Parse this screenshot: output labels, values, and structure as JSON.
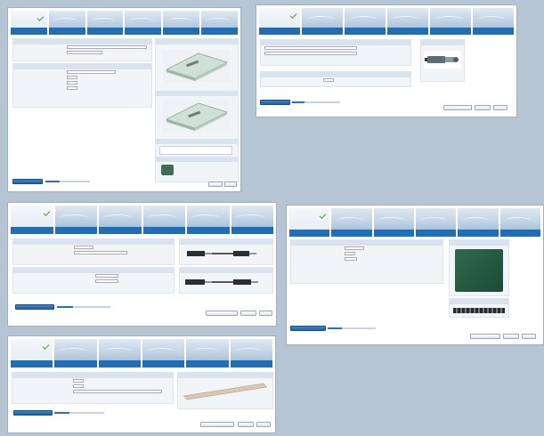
{
  "panels": [
    {
      "id": "p1",
      "tabs": [
        "",
        "",
        "",
        "",
        "",
        ""
      ],
      "active": 0,
      "section_titles": [
        "",
        "",
        ""
      ],
      "rows": [
        "",
        "",
        "",
        "",
        "",
        ""
      ],
      "buttons": [
        "",
        ""
      ],
      "logo": ""
    },
    {
      "id": "p2",
      "tabs": [
        "",
        "",
        "",
        "",
        "",
        ""
      ],
      "active": 0,
      "section_titles": [
        "",
        "",
        ""
      ],
      "rows": [
        "",
        "",
        ""
      ],
      "buttons": [
        "",
        "",
        ""
      ],
      "logo": ""
    },
    {
      "id": "p3",
      "tabs": [
        "",
        "",
        "",
        "",
        "",
        ""
      ],
      "active": 0,
      "section_titles": [
        "",
        "",
        "",
        ""
      ],
      "rows": [
        "",
        "",
        "",
        ""
      ],
      "buttons": [
        "",
        "",
        ""
      ],
      "logo": ""
    },
    {
      "id": "p4",
      "tabs": [
        "",
        "",
        "",
        "",
        "",
        ""
      ],
      "active": 0,
      "section_titles": [
        "",
        "",
        ""
      ],
      "rows": [
        "",
        "",
        ""
      ],
      "buttons": [
        "",
        "",
        ""
      ],
      "logo": ""
    },
    {
      "id": "p5",
      "tabs": [
        "",
        "",
        "",
        "",
        "",
        ""
      ],
      "active": 0,
      "section_titles": [
        "",
        ""
      ],
      "rows": [
        "",
        "",
        ""
      ],
      "buttons": [
        "",
        "",
        ""
      ],
      "logo": ""
    }
  ],
  "progress": [
    0.32,
    0.25,
    0.3,
    0.3,
    0.3
  ],
  "colors": {
    "background": "#b5c5d3",
    "tab_bar": "#1f6fb8",
    "section_header": "#d8e3ee",
    "primary_button": "#2a72b6"
  }
}
